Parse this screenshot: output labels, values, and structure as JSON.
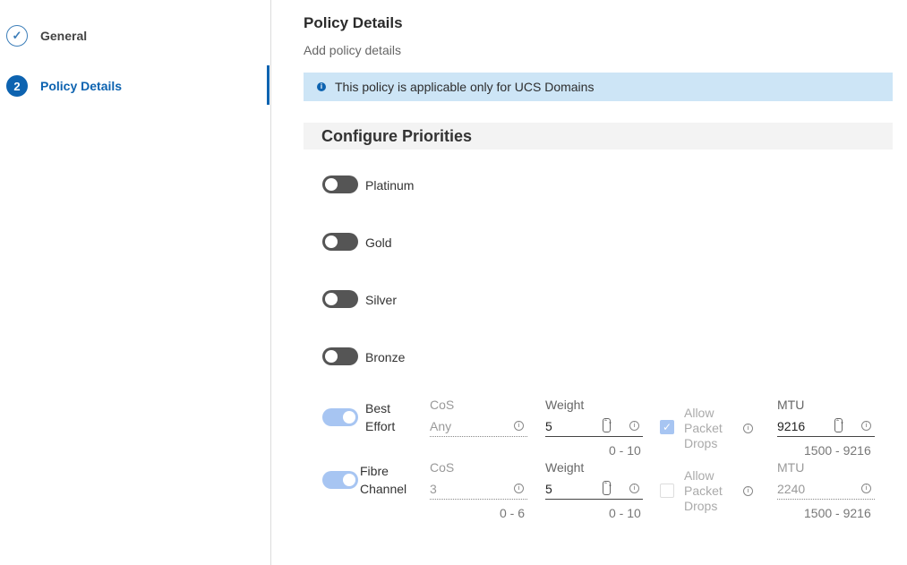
{
  "wizard": {
    "steps": [
      {
        "marker": "✓",
        "label": "General"
      },
      {
        "marker": "2",
        "label": "Policy Details"
      }
    ]
  },
  "page": {
    "title": "Policy Details",
    "subtitle": "Add policy details",
    "info_icon": "i",
    "info": "This policy is applicable only for UCS Domains"
  },
  "section": {
    "title": "Configure Priorities"
  },
  "priorities": {
    "platinum": {
      "label": "Platinum",
      "enabled": false
    },
    "gold": {
      "label": "Gold",
      "enabled": false
    },
    "silver": {
      "label": "Silver",
      "enabled": false
    },
    "bronze": {
      "label": "Bronze",
      "enabled": false
    },
    "best_effort": {
      "label_line1": "Best",
      "label_line2": "Effort",
      "enabled": true,
      "cos_label": "CoS",
      "cos_value": "Any",
      "weight_label": "Weight",
      "weight_value": "5",
      "weight_range": "0 - 10",
      "allow_packet_drops_line1": "Allow",
      "allow_packet_drops_line2": "Packet",
      "allow_packet_drops_line3": "Drops",
      "allow_packet_drops_checked": true,
      "mtu_label": "MTU",
      "mtu_value": "9216",
      "mtu_range": "1500 - 9216"
    },
    "fibre_channel": {
      "label_line1": "Fibre",
      "label_line2": "Channel",
      "enabled": true,
      "cos_label": "CoS",
      "cos_value": "3",
      "cos_range": "0 - 6",
      "weight_label": "Weight",
      "weight_value": "5",
      "weight_range": "0 - 10",
      "allow_packet_drops_line1": "Allow",
      "allow_packet_drops_line2": "Packet",
      "allow_packet_drops_line3": "Drops",
      "allow_packet_drops_checked": false,
      "mtu_label": "MTU",
      "mtu_value": "2240",
      "mtu_range": "1500 - 9216"
    }
  },
  "icons": {
    "info": "i",
    "spin": "⌃⌄",
    "check": "✓"
  },
  "colors": {
    "accent": "#0d63b0",
    "banner": "#cde5f6",
    "toggle_on": "#a7c5f2",
    "toggle_off": "#555555"
  }
}
